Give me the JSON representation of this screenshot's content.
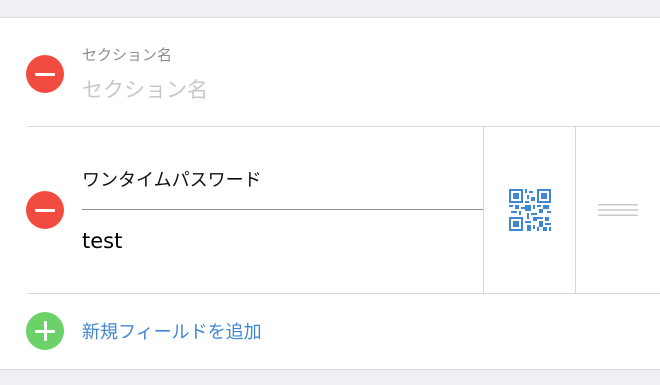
{
  "section": {
    "label": "セクション名",
    "placeholder": "セクション名"
  },
  "field": {
    "name": "ワンタイムパスワード",
    "value": "test"
  },
  "icons": {
    "remove": "minus-circle-icon",
    "qr": "qr-code-icon",
    "drag": "drag-handle-icon",
    "add": "plus-circle-icon"
  },
  "add_field": {
    "label": "新規フィールドを追加"
  },
  "colors": {
    "remove": "#f14c3f",
    "add": "#6bd26a",
    "accent": "#3f86d4"
  }
}
